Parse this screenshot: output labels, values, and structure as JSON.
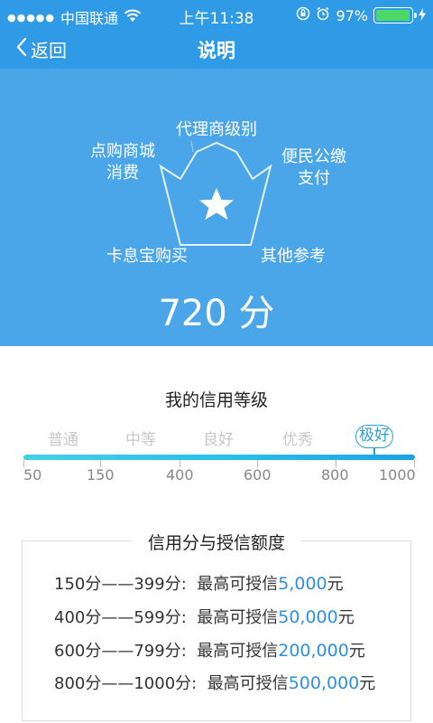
{
  "status_bar": {
    "signal": "●●●●●",
    "carrier": "中国联通",
    "wifi_icon": "wifi-icon",
    "time": "上午11:38",
    "battery_percent": "97%",
    "battery_level": 0.97,
    "charging_icon": "bolt-icon"
  },
  "nav": {
    "back_label": "返回",
    "title": "说明"
  },
  "hero": {
    "labels": {
      "agent_level": "代理商级别",
      "mall_consumption": "点购商城\n消费",
      "public_payment": "便民公缴\n支付",
      "card_purchase": "卡息宝购买",
      "other_reference": "其他参考"
    },
    "score": "720 分",
    "colors": {
      "background": "#4aa6e9",
      "header": "#2f9ae6"
    }
  },
  "credit_level": {
    "title": "我的信用等级",
    "levels": [
      "普通",
      "中等",
      "良好",
      "优秀",
      "极好"
    ],
    "active_level": "极好",
    "ticks": [
      "50",
      "150",
      "400",
      "600",
      "800",
      "1000"
    ]
  },
  "quota": {
    "title": "信用分与授信额度",
    "rows": [
      {
        "range": "150分——399分:",
        "text": "最高可授信",
        "amount": "5,000",
        "unit": "元"
      },
      {
        "range": "400分——599分:",
        "text": "最高可授信",
        "amount": "50,000",
        "unit": "元"
      },
      {
        "range": "600分——799分:",
        "text": "最高可授信",
        "amount": "200,000",
        "unit": "元"
      },
      {
        "range": "800分——1000分:",
        "text": "最高可授信",
        "amount": "500,000",
        "unit": "元"
      }
    ]
  }
}
